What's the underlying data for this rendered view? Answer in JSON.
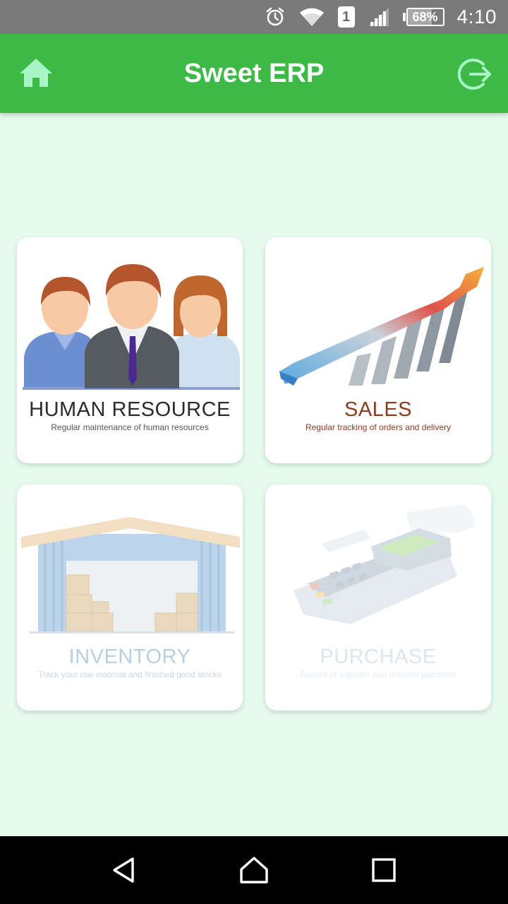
{
  "status_bar": {
    "sim_slot": "1",
    "battery_label": "68%",
    "battery_level": 0.68,
    "time": "4:10",
    "icons": [
      "alarm-icon",
      "wifi-icon",
      "sim-icon",
      "signal-icon",
      "battery-icon"
    ]
  },
  "app_bar": {
    "title": "Sweet ERP",
    "home_icon": "home-icon",
    "logout_icon": "logout-icon",
    "color": "#3db946",
    "icon_color": "#a8f5c8"
  },
  "modules": [
    {
      "title": "HUMAN RESOURCE",
      "subtitle": "Regular maintenance of human resources"
    },
    {
      "title": "SALES",
      "subtitle": "Regular tracking of orders and delivery"
    },
    {
      "title": "INVENTORY",
      "subtitle": "Track your raw material and finished good stocks"
    },
    {
      "title": "PURCHASE",
      "subtitle": "Record of supplies and material purchase"
    }
  ],
  "nav_bar": {
    "icons": [
      "back-icon",
      "home-nav-icon",
      "recents-icon"
    ]
  },
  "colors": {
    "background": "#e6fbee",
    "status_bar": "#7a7a7a",
    "nav_bar": "#000000"
  }
}
